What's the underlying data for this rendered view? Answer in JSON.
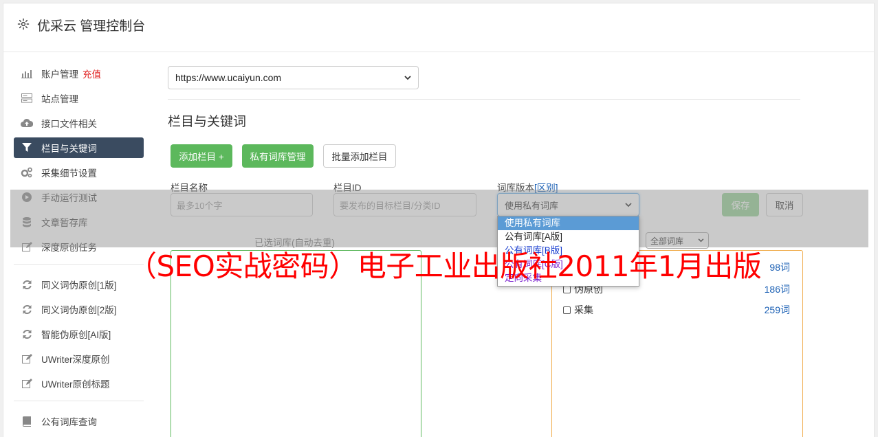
{
  "header": {
    "title": "优采云 管理控制台"
  },
  "sidebar": {
    "group1": [
      {
        "label": "账户管理",
        "tag": "充值",
        "icon": "bar-chart-icon"
      },
      {
        "label": "站点管理",
        "icon": "server-icon"
      },
      {
        "label": "接口文件相关",
        "icon": "cloud-upload-icon"
      },
      {
        "label": "栏目与关键词",
        "icon": "filter-icon",
        "active": true
      },
      {
        "label": "采集细节设置",
        "icon": "cogs-icon"
      },
      {
        "label": "手动运行测试",
        "icon": "play-icon"
      },
      {
        "label": "文章暂存库",
        "icon": "database-icon"
      },
      {
        "label": "深度原创任务",
        "icon": "edit-icon"
      }
    ],
    "group2": [
      {
        "label": "同义词伪原创[1版]",
        "icon": "refresh-icon"
      },
      {
        "label": "同义词伪原创[2版]",
        "icon": "refresh-icon"
      },
      {
        "label": "智能伪原创[AI版]",
        "icon": "refresh-icon"
      },
      {
        "label": "UWriter深度原创",
        "icon": "edit-icon"
      },
      {
        "label": "UWriter原创标题",
        "icon": "edit-icon"
      }
    ],
    "group3": [
      {
        "label": "公有词库查询",
        "icon": "book-icon"
      }
    ]
  },
  "main": {
    "site_select": "https://www.ucaiyun.com",
    "section_title": "栏目与关键词",
    "buttons": {
      "add_column": "添加栏目 +",
      "private_lib": "私有词库管理",
      "batch_add": "批量添加栏目",
      "save": "保存",
      "cancel": "取消"
    },
    "form": {
      "name_label": "栏目名称",
      "name_placeholder": "最多10个字",
      "id_label": "栏目ID",
      "id_placeholder": "要发布的目标栏目/分类ID",
      "version_label": "词库版本",
      "version_link": "[区别]",
      "version_selected": "使用私有词库"
    },
    "selected_lib_label": "已选词库(自动去重)",
    "lib_filter": "全部词库",
    "keyword_rows": [
      {
        "label": "",
        "count": "98词"
      },
      {
        "label": "伪原创",
        "count": "186词"
      },
      {
        "label": "采集",
        "count": "259词"
      }
    ],
    "dropdown_options": [
      "使用私有词库",
      "公有词库[A版]",
      "公有词库[B版]",
      "公有词库[C版]",
      "定向采集"
    ]
  },
  "watermark": "（SEO实战密码）电子工业出版社2011年1月出版",
  "colors": {
    "green": "#5cb85c",
    "active_nav": "#3a4b60",
    "link": "#1a5fb4",
    "watermark": "#ff0000"
  }
}
